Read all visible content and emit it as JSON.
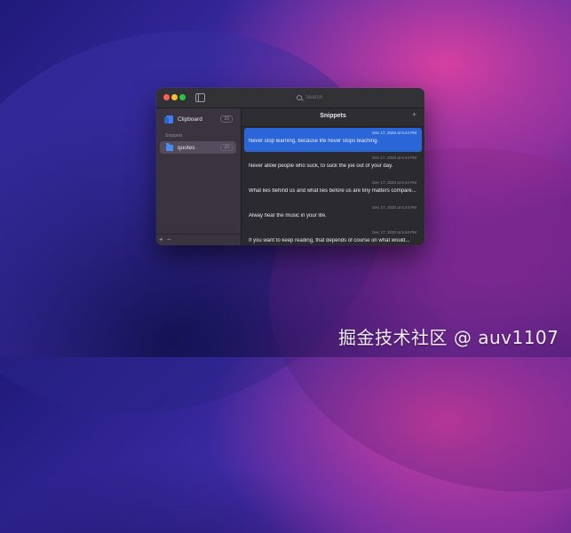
{
  "window": {
    "search_placeholder": "Search"
  },
  "sidebar": {
    "clipboard": {
      "label": "Clipboard",
      "count": "23"
    },
    "section_header": "Snippets",
    "items": [
      {
        "label": "quotes",
        "count": "10"
      }
    ],
    "footer": {
      "add": "+",
      "remove": "−"
    }
  },
  "main": {
    "title": "Snippets",
    "add": "+",
    "snippets": [
      {
        "timestamp": "Dec 17, 2020 at 5:44 PM",
        "text": "Never stop learning, because life never stops teaching.",
        "selected": true
      },
      {
        "timestamp": "Dec 17, 2020 at 5:44 PM",
        "text": "Never allow people who suck, to suck the joe out of your day."
      },
      {
        "timestamp": "Dec 17, 2020 at 5:44 PM",
        "text": "What lies behind us and what lies before us are tiny matters compare..."
      },
      {
        "timestamp": "Dec 17, 2020 at 5:44 PM",
        "text": "Alway hear the music in your life."
      },
      {
        "timestamp": "Dec 17, 2020 at 5:44 PM",
        "text": "If you want to keep reading, that depends of course on what would..."
      }
    ]
  },
  "watermark": "掘金技术社区 @ auv1107",
  "colors": {
    "accent": "#2a66d8",
    "sidebar_selected": "#544b5c"
  },
  "icons": [
    "close-icon",
    "minimize-icon",
    "zoom-icon",
    "sidebar-toggle-icon",
    "search-icon",
    "clipboard-icon",
    "folder-icon",
    "plus-icon",
    "minus-icon"
  ]
}
